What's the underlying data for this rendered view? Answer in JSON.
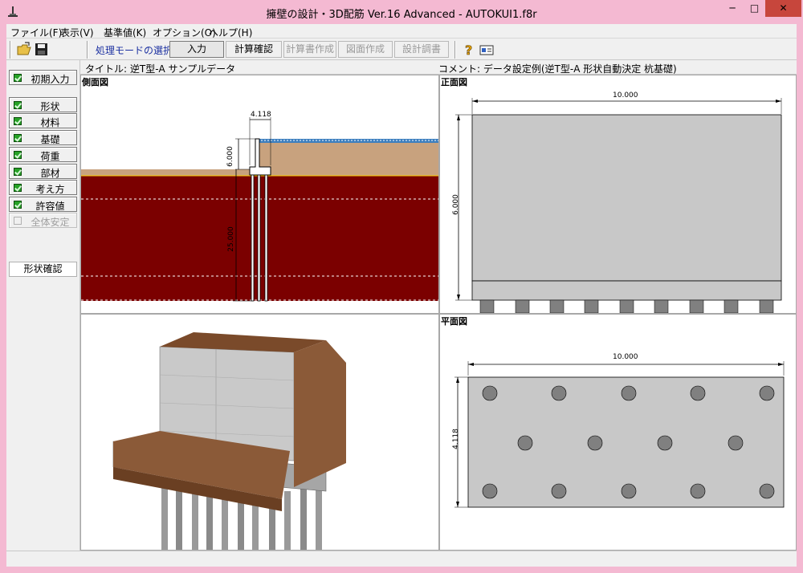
{
  "window": {
    "title": "擁壁の設計・3D配筋 Ver.16 Advanced  - AUTOKUI1.f8r",
    "min_label": "─",
    "max_label": "□",
    "close_label": "✕"
  },
  "menu": {
    "file": "ファイル(F)",
    "view": "表示(V)",
    "base_values": "基準値(K)",
    "options": "オプション(O)",
    "help": "ヘルプ(H)"
  },
  "toolbar": {
    "icons": [
      "open-folder-icon",
      "save-icon",
      "help-icon",
      "info-icon"
    ],
    "mode_label": "処理モードの選択",
    "modes": [
      "入力",
      "計算確認",
      "計算書作成",
      "図面作成",
      "設計調書"
    ]
  },
  "info": {
    "title_line": "タイトル: 逆T型-A サンプルデータ",
    "comment_line": "コメント: データ設定例(逆T型-A  形状自動決定  杭基礎)"
  },
  "sidebar": {
    "initial_input": "初期入力",
    "items": [
      "形状",
      "材料",
      "基礎",
      "荷重",
      "部材",
      "考え方",
      "許容値",
      "全体安定"
    ],
    "shape_check": "形状確認"
  },
  "panes": {
    "side_view": {
      "title": "側面図",
      "dim_top": "4.118",
      "dim_height": "6.000",
      "dim_pile": "25.000"
    },
    "front_view": {
      "title": "正面図",
      "dim_width": "10.000",
      "dim_height": "6.000"
    },
    "plan_view": {
      "title": "平面図",
      "dim_width": "10.000",
      "dim_depth": "4.118"
    },
    "view_3d": {}
  },
  "colors": {
    "window_frame": "#f4b9d2",
    "soil_backfill": "#c8a27e",
    "ground_dark": "#7b0000",
    "water_blue": "#3d7fbf",
    "wall_gray": "#c8c8c8",
    "pile_gray": "#808080"
  }
}
